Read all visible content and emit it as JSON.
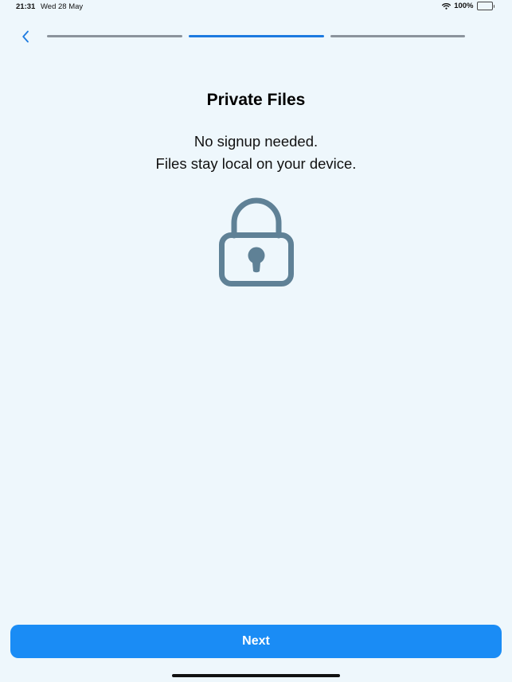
{
  "status_bar": {
    "time": "21:31",
    "date": "Wed 28 May",
    "battery_percent": "100%",
    "battery_level": 1.0,
    "icons": [
      "wifi-icon",
      "battery-icon"
    ]
  },
  "nav": {
    "back_icon": "chevron-left-icon",
    "progress": {
      "total_steps": 3,
      "current_step": 2
    }
  },
  "content": {
    "title": "Private Files",
    "subtitle_lines": [
      "No signup needed.",
      "Files stay local on your device."
    ],
    "illustration_icon": "lock-icon"
  },
  "footer": {
    "next_label": "Next"
  },
  "colors": {
    "background": "#eef7fc",
    "accent": "#1c7ae0",
    "button": "#1a8cf5",
    "progress_inactive": "#8b939c",
    "lock": "#5f8196"
  }
}
